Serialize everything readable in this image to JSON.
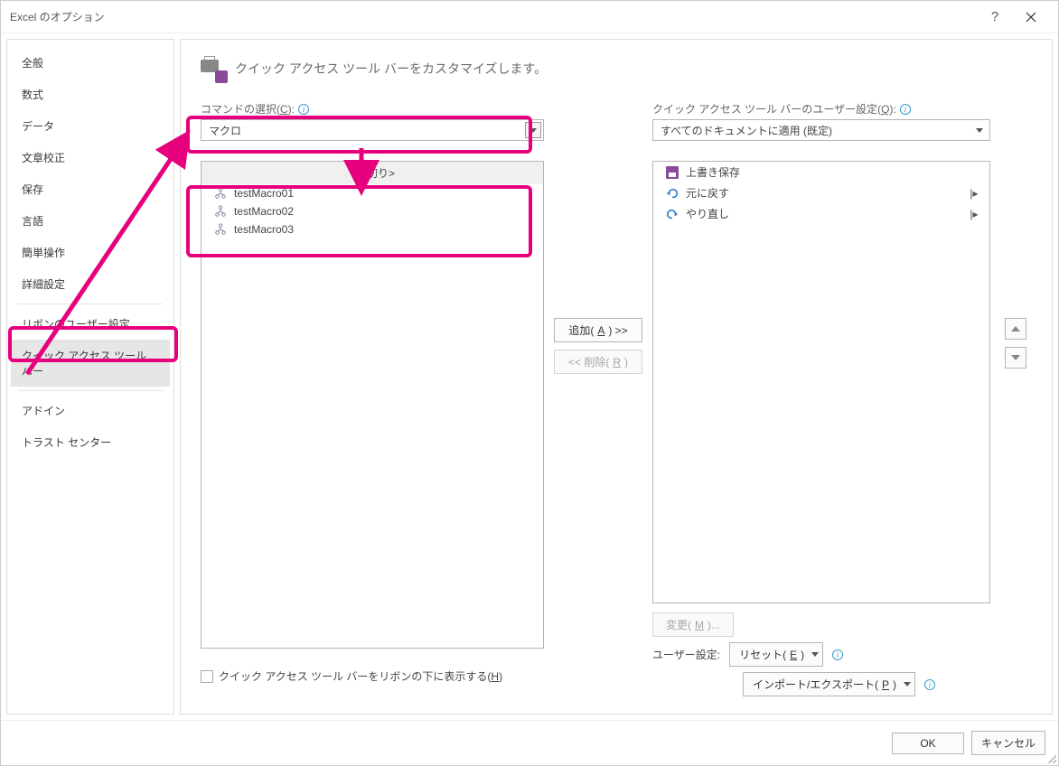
{
  "window": {
    "title": "Excel のオプション",
    "help_tooltip": "ヘルプ",
    "close_tooltip": "閉じる"
  },
  "sidebar": {
    "items": [
      {
        "label": "全般"
      },
      {
        "label": "数式"
      },
      {
        "label": "データ"
      },
      {
        "label": "文章校正"
      },
      {
        "label": "保存"
      },
      {
        "label": "言語"
      },
      {
        "label": "簡単操作"
      },
      {
        "label": "詳細設定"
      },
      {
        "sep": true
      },
      {
        "label": "リボンのユーザー設定"
      },
      {
        "label": "クイック アクセス ツール バー",
        "selected": true
      },
      {
        "sep": true
      },
      {
        "label": "アドイン"
      },
      {
        "label": "トラスト センター"
      }
    ]
  },
  "header": {
    "text": "クイック アクセス ツール バーをカスタマイズします。"
  },
  "left": {
    "choose_label_prefix": "コマンドの選択(",
    "choose_label_key": "C",
    "choose_label_suffix": "):",
    "choose_value": "マクロ",
    "list": {
      "separator_head": "<区切り>",
      "items": [
        {
          "label": "testMacro01"
        },
        {
          "label": "testMacro02"
        },
        {
          "label": "testMacro03"
        }
      ]
    },
    "show_below_prefix": "クイック アクセス ツール バーをリボンの下に表示する(",
    "show_below_key": "H",
    "show_below_suffix": ")"
  },
  "mid": {
    "add_prefix": "追加(",
    "add_key": "A",
    "add_suffix": ") >>",
    "remove_prefix": "<< 削除(",
    "remove_key": "R",
    "remove_suffix": ")"
  },
  "right": {
    "customize_label_prefix": "クイック アクセス ツール バーのユーザー設定(",
    "customize_label_key": "Q",
    "customize_label_suffix": "):",
    "scope_value": "すべてのドキュメントに適用 (既定)",
    "list": {
      "items": [
        {
          "icon": "save",
          "label": "上書き保存"
        },
        {
          "icon": "undo",
          "label": "元に戻す",
          "dropdown": true
        },
        {
          "icon": "redo",
          "label": "やり直し",
          "dropdown": true
        }
      ]
    },
    "modify_prefix": "変更(",
    "modify_key": "M",
    "modify_suffix": ")...",
    "customizations_label": "ユーザー設定:",
    "reset_prefix": "リセット(",
    "reset_key": "E",
    "reset_suffix": ")",
    "import_export_prefix": "インポート/エクスポート(",
    "import_export_key": "P",
    "import_export_suffix": ")"
  },
  "footer": {
    "ok": "OK",
    "cancel": "キャンセル"
  }
}
